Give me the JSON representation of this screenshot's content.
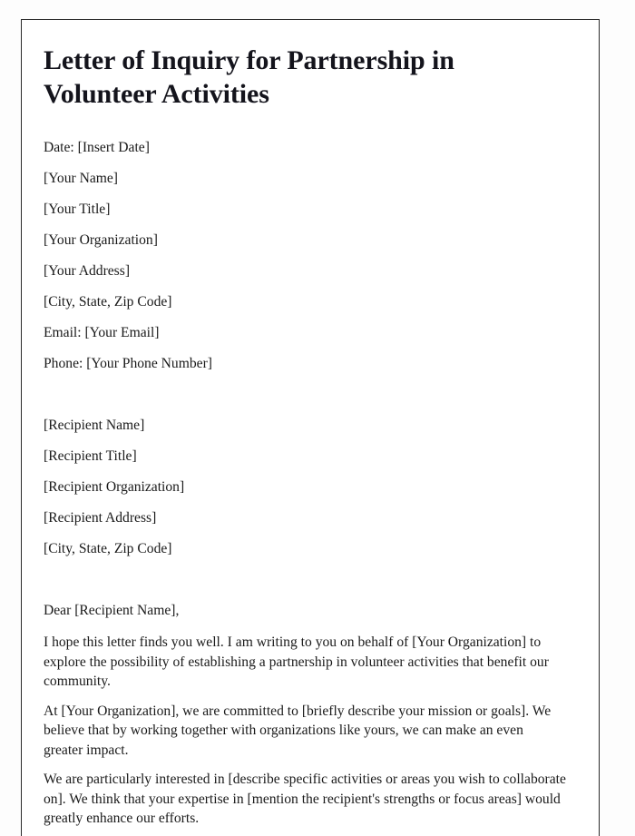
{
  "document": {
    "title": "Letter of Inquiry for Partnership in Volunteer Activities",
    "sender_block": [
      "Date: [Insert Date]",
      "[Your Name]",
      "[Your Title]",
      "[Your Organization]",
      "[Your Address]",
      "[City, State, Zip Code]",
      "Email: [Your Email]",
      "Phone: [Your Phone Number]"
    ],
    "recipient_block": [
      "[Recipient Name]",
      "[Recipient Title]",
      "[Recipient Organization]",
      "[Recipient Address]",
      "[City, State, Zip Code]"
    ],
    "salutation": "Dear [Recipient Name],",
    "paragraphs": [
      "I hope this letter finds you well. I am writing to you on behalf of [Your Organization] to explore the possibility of establishing a partnership in volunteer activities that benefit our community.",
      "At [Your Organization], we are committed to [briefly describe your mission or goals]. We believe that by working together with organizations like yours, we can make an even greater impact.",
      "We are particularly interested in [describe specific activities or areas you wish to collaborate on]. We think that your expertise in [mention the recipient's strengths or focus areas] would greatly enhance our efforts."
    ]
  },
  "theme": {
    "page_background": "#ffffff",
    "canvas_background": "#fdfdfd",
    "border_color": "#2b2b2b",
    "text_color": "#1a1a1a",
    "title_color": "#14141c"
  }
}
